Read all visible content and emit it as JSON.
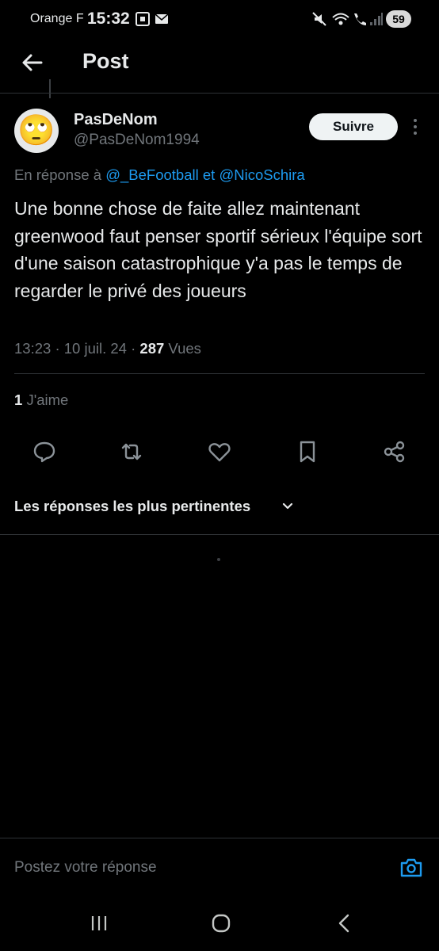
{
  "status_bar": {
    "carrier": "Orange F",
    "time": "15:32",
    "battery": "59"
  },
  "header": {
    "title": "Post"
  },
  "tweet": {
    "author_name": "PasDeNom",
    "author_handle": "@PasDeNom1994",
    "avatar_emoji": "🙄",
    "follow_label": "Suivre",
    "reply_prefix": "En réponse à",
    "reply_user_1": "@_BeFootball",
    "reply_joiner": "et",
    "reply_user_2": "@NicoSchira",
    "text": "Une bonne chose de faite allez maintenant greenwood faut penser sportif sérieux l'équipe sort d'une saison catastrophique y'a pas le temps de regarder le privé des joueurs",
    "time": "13:23",
    "sep": "·",
    "date": "10 juil. 24",
    "views_count": "287",
    "views_label": "Vues",
    "likes_count": "1",
    "likes_label": "J'aime"
  },
  "actions": [
    "reply-icon",
    "retweet-icon",
    "like-icon",
    "bookmark-icon",
    "share-icon"
  ],
  "sort": {
    "label": "Les réponses les plus pertinentes"
  },
  "composer": {
    "placeholder": "Postez votre réponse"
  },
  "colors": {
    "background": "#000000",
    "text": "#e7e9ea",
    "secondary": "#71767b",
    "link": "#1d9bf0",
    "divider": "#2f3336"
  }
}
